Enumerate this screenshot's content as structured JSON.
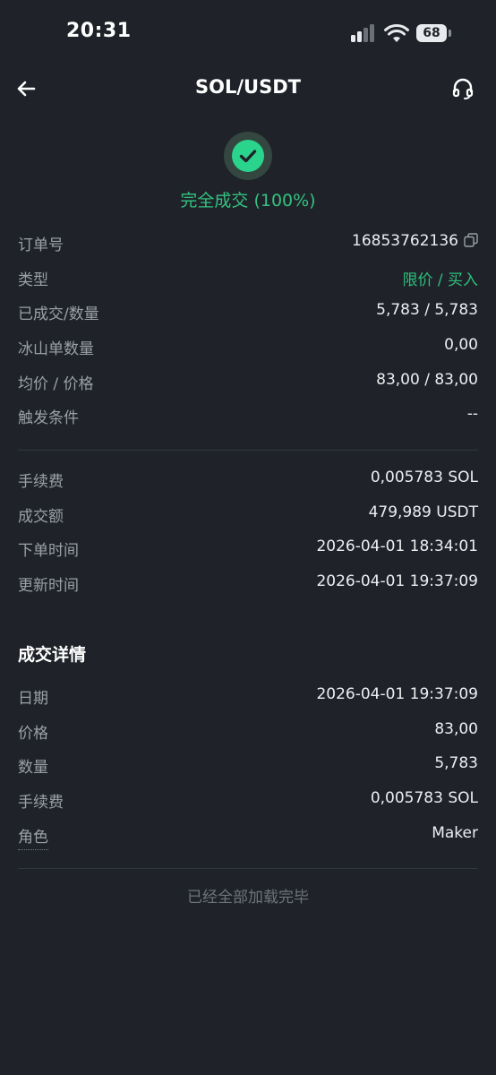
{
  "status_bar": {
    "time": "20:31",
    "battery": "68"
  },
  "nav": {
    "title": "SOL/USDT",
    "back_icon": "back-arrow-icon",
    "support_icon": "headset-icon"
  },
  "order_status": {
    "icon": "check-icon",
    "text": "完全成交 (100%)",
    "color": "#2bd48c"
  },
  "order_info": [
    {
      "label": "订单号",
      "value": "16853762136"
    },
    {
      "label": "类型",
      "value": "限价 / 买入"
    },
    {
      "label": "已成交/数量",
      "value": "5,783 / 5,783"
    },
    {
      "label": "冰山单数量",
      "value": "0,00"
    },
    {
      "label": "均价 / 价格",
      "value": "83,00 / 83,00"
    },
    {
      "label": "触发条件",
      "value": "--"
    }
  ],
  "fee_info": [
    {
      "label": "手续费",
      "value": "0,005783 SOL"
    },
    {
      "label": "成交额",
      "value": "479,989 USDT"
    },
    {
      "label": "下单时间",
      "value": "2026-04-01 18:34:01"
    },
    {
      "label": "更新时间",
      "value": "2026-04-01 19:37:09"
    }
  ],
  "trade_details": {
    "title": "成交详情",
    "rows": [
      {
        "label": "日期",
        "value": "2026-04-01 19:37:09"
      },
      {
        "label": "价格",
        "value": "83,00"
      },
      {
        "label": "数量",
        "value": "5,783"
      },
      {
        "label": "手续费",
        "value": "0,005783 SOL"
      },
      {
        "label": "角色",
        "value": "Maker"
      }
    ]
  },
  "footer": "已经全部加载完毕"
}
